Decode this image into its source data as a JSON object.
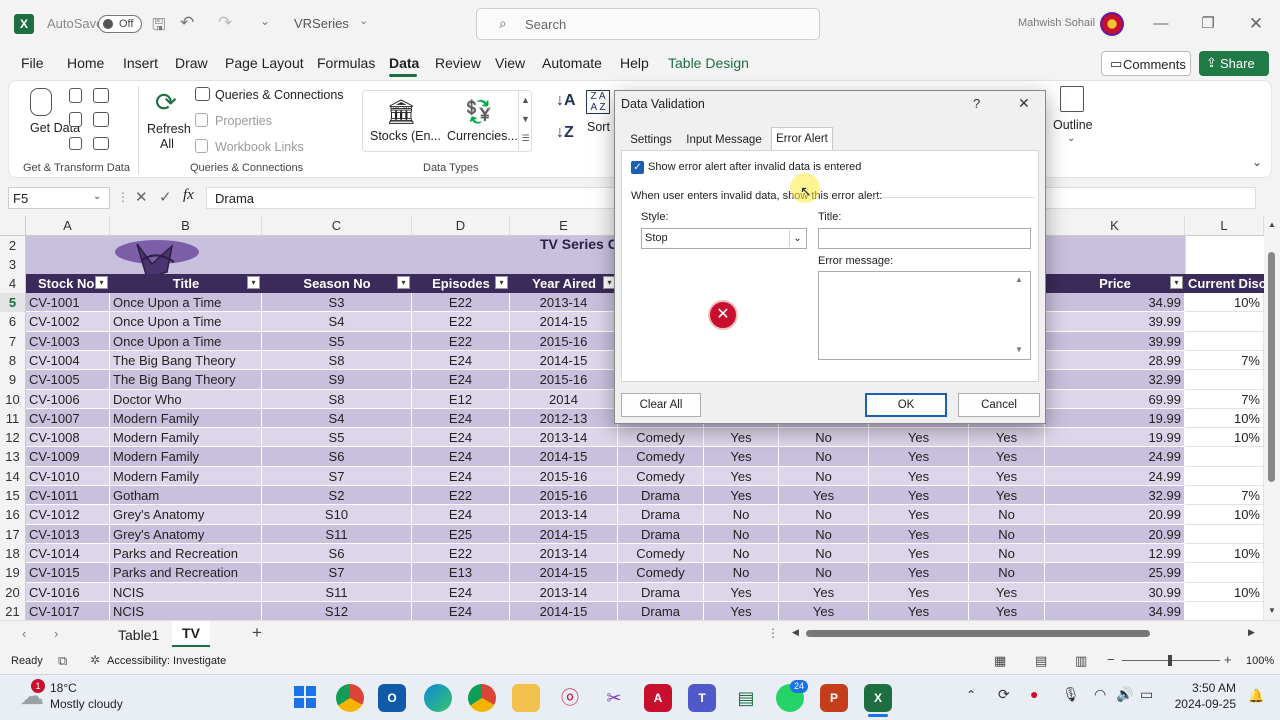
{
  "titlebar": {
    "autosave": "AutoSave",
    "toggle": "Off",
    "filename": "VRSeries",
    "search": "Search",
    "user": "Mahwish Sohail"
  },
  "menu": [
    "File",
    "Home",
    "Insert",
    "Draw",
    "Page Layout",
    "Formulas",
    "Data",
    "Review",
    "View",
    "Automate",
    "Help",
    "Table Design"
  ],
  "menu_active": "Data",
  "actions": {
    "comments": "Comments",
    "share": "Share"
  },
  "ribbon": {
    "get_data": "Get Data",
    "get_transform": "Get & Transform Data",
    "refresh_all": "Refresh All",
    "queries_connections": "Queries & Connections",
    "properties": "Properties",
    "workbook_links": "Workbook Links",
    "queries_group": "Queries & Connections",
    "stocks": "Stocks (En...",
    "currencies": "Currencies...",
    "data_types": "Data Types",
    "sort": "Sort",
    "outline": "Outline"
  },
  "formula_bar": {
    "namebox": "F5",
    "formula": "Drama"
  },
  "columns": [
    "A",
    "B",
    "C",
    "D",
    "E",
    "K",
    "L"
  ],
  "sheet_title": "TV Series C",
  "headers": [
    "Stock No.",
    "Title",
    "Season No",
    "Episodes",
    "Year Aired",
    "Price",
    "Current Disc"
  ],
  "rows": [
    {
      "n": "5",
      "a": "CV-1001",
      "b": "Once Upon a Time",
      "c": "S3",
      "d": "E22",
      "e": "2013-14",
      "k": "34.99",
      "l": "10%"
    },
    {
      "n": "6",
      "a": "CV-1002",
      "b": "Once Upon a Time",
      "c": "S4",
      "d": "E22",
      "e": "2014-15",
      "k": "39.99",
      "l": ""
    },
    {
      "n": "7",
      "a": "CV-1003",
      "b": "Once Upon a Time",
      "c": "S5",
      "d": "E22",
      "e": "2015-16",
      "k": "39.99",
      "l": ""
    },
    {
      "n": "8",
      "a": "CV-1004",
      "b": "The Big Bang Theory",
      "c": "S8",
      "d": "E24",
      "e": "2014-15",
      "k": "28.99",
      "l": "7%"
    },
    {
      "n": "9",
      "a": "CV-1005",
      "b": "The Big Bang Theory",
      "c": "S9",
      "d": "E24",
      "e": "2015-16",
      "k": "32.99",
      "l": ""
    },
    {
      "n": "10",
      "a": "CV-1006",
      "b": "Doctor Who",
      "c": "S8",
      "d": "E12",
      "e": "2014",
      "k": "69.99",
      "l": "7%"
    },
    {
      "n": "11",
      "a": "CV-1007",
      "b": "Modern Family",
      "c": "S4",
      "d": "E24",
      "e": "2012-13",
      "k": "19.99",
      "l": "10%"
    },
    {
      "n": "12",
      "a": "CV-1008",
      "b": "Modern Family",
      "c": "S5",
      "d": "E24",
      "e": "2013-14",
      "f": "Comedy",
      "g": "Yes",
      "h": "No",
      "i": "Yes",
      "j": "Yes",
      "k": "19.99",
      "l": "10%"
    },
    {
      "n": "13",
      "a": "CV-1009",
      "b": "Modern Family",
      "c": "S6",
      "d": "E24",
      "e": "2014-15",
      "f": "Comedy",
      "g": "Yes",
      "h": "No",
      "i": "Yes",
      "j": "Yes",
      "k": "24.99",
      "l": ""
    },
    {
      "n": "14",
      "a": "CV-1010",
      "b": "Modern Family",
      "c": "S7",
      "d": "E24",
      "e": "2015-16",
      "f": "Comedy",
      "g": "Yes",
      "h": "No",
      "i": "Yes",
      "j": "Yes",
      "k": "24.99",
      "l": ""
    },
    {
      "n": "15",
      "a": "CV-1011",
      "b": "Gotham",
      "c": "S2",
      "d": "E22",
      "e": "2015-16",
      "f": "Drama",
      "g": "Yes",
      "h": "Yes",
      "i": "Yes",
      "j": "Yes",
      "k": "32.99",
      "l": "7%"
    },
    {
      "n": "16",
      "a": "CV-1012",
      "b": "Grey's Anatomy",
      "c": "S10",
      "d": "E24",
      "e": "2013-14",
      "f": "Drama",
      "g": "No",
      "h": "No",
      "i": "Yes",
      "j": "No",
      "k": "20.99",
      "l": "10%"
    },
    {
      "n": "17",
      "a": "CV-1013",
      "b": "Grey's Anatomy",
      "c": "S11",
      "d": "E25",
      "e": "2014-15",
      "f": "Drama",
      "g": "No",
      "h": "No",
      "i": "Yes",
      "j": "No",
      "k": "20.99",
      "l": ""
    },
    {
      "n": "18",
      "a": "CV-1014",
      "b": "Parks and Recreation",
      "c": "S6",
      "d": "E22",
      "e": "2013-14",
      "f": "Comedy",
      "g": "No",
      "h": "No",
      "i": "Yes",
      "j": "No",
      "k": "12.99",
      "l": "10%"
    },
    {
      "n": "19",
      "a": "CV-1015",
      "b": "Parks and Recreation",
      "c": "S7",
      "d": "E13",
      "e": "2014-15",
      "f": "Comedy",
      "g": "No",
      "h": "No",
      "i": "Yes",
      "j": "No",
      "k": "25.99",
      "l": ""
    },
    {
      "n": "20",
      "a": "CV-1016",
      "b": "NCIS",
      "c": "S11",
      "d": "E24",
      "e": "2013-14",
      "f": "Drama",
      "g": "Yes",
      "h": "Yes",
      "i": "Yes",
      "j": "Yes",
      "k": "30.99",
      "l": "10%"
    },
    {
      "n": "21",
      "a": "CV-1017",
      "b": "NCIS",
      "c": "S12",
      "d": "E24",
      "e": "2014-15",
      "f": "Drama",
      "g": "Yes",
      "h": "Yes",
      "i": "Yes",
      "j": "Yes",
      "k": "34.99",
      "l": ""
    }
  ],
  "row_numbers_top": [
    "2",
    "3",
    "4"
  ],
  "sheets": [
    "Table1",
    "TV"
  ],
  "active_sheet": "TV",
  "status": {
    "ready": "Ready",
    "accessibility": "Accessibility: Investigate",
    "zoom": "100%"
  },
  "taskbar": {
    "temp": "18°C",
    "weather": "Mostly cloudy",
    "time": "3:50 AM",
    "date": "2024-09-25",
    "badge": "1",
    "badge2": "24"
  },
  "dialog": {
    "title": "Data Validation",
    "help": "?",
    "close": "✕",
    "tabs": [
      "Settings",
      "Input Message",
      "Error Alert"
    ],
    "checkbox": "Show error alert after invalid data is entered",
    "desc": "When user enters invalid data, show this error alert:",
    "style_label": "Style:",
    "style_value": "Stop",
    "title_label": "Title:",
    "title_value": "",
    "message_label": "Error message:",
    "message_value": "",
    "clear_all": "Clear All",
    "ok": "OK",
    "cancel": "Cancel"
  },
  "colors": {
    "excel_green": "#1d6f42",
    "header_purple": "#3a2b5a",
    "row_a": "#c9c0dd",
    "row_b": "#ddd6ea",
    "share": "#1f7a45",
    "stop_red": "#c8102e"
  }
}
